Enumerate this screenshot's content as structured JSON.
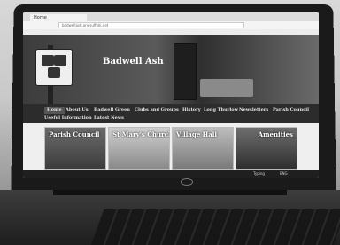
{
  "browser": {
    "tab_title": "Home",
    "url": "badwellash.onesuffolk.net"
  },
  "site": {
    "title": "Badwell Ash",
    "nav": [
      "Home",
      "About Us",
      "Badwell Green",
      "Clubs and Groups",
      "History",
      "Long Thurlow",
      "Newsletters",
      "Parish Council",
      "Useful Information",
      "Latest News"
    ]
  },
  "cards": [
    {
      "label": "Parish Council"
    },
    {
      "label": "St Mary's Church"
    },
    {
      "label": "Village Hall"
    },
    {
      "label": "Amenities"
    }
  ],
  "taskbar": {
    "status": "Typing",
    "lang": "ENG"
  },
  "laptop": {
    "brand_icon": "hp-logo"
  }
}
